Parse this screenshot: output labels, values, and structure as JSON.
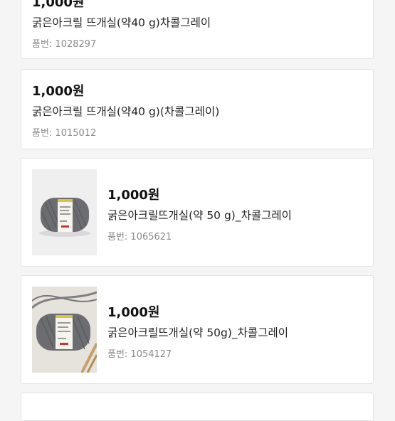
{
  "products": [
    {
      "price": "1,000원",
      "name": "굵은아크릴 뜨개실(약40 g)차콜그레이",
      "code": "품번: 1028297"
    },
    {
      "price": "1,000원",
      "name": "굵은아크릴 뜨개실(약40 g)(차콜그레이)",
      "code": "품번: 1015012"
    },
    {
      "price": "1,000원",
      "name": "굵은아크릴뜨개실(약 50 g)_차콜그레이",
      "code": "품번: 1065621",
      "image": "yarn-ball-image"
    },
    {
      "price": "1,000원",
      "name": "굵은아크릴뜨개실(약 50g)_차콜그레이",
      "code": "품번: 1054127",
      "image": "yarn-ball-image"
    }
  ],
  "colors": {
    "card_border": "#e3e3e3",
    "code_text": "#8a8a8a",
    "yarn": "#6b6d70",
    "background": "#f5f5f5"
  }
}
